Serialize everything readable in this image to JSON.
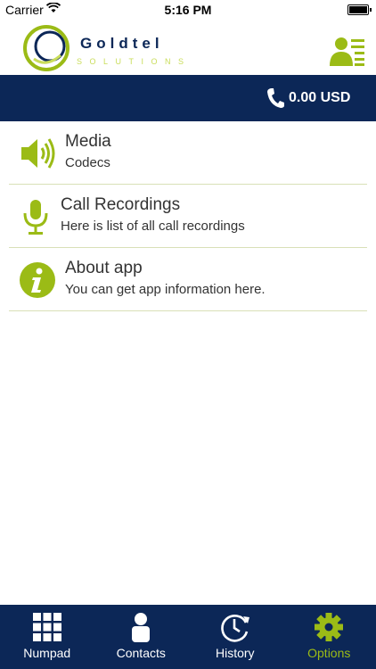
{
  "status_bar": {
    "carrier": "Carrier",
    "time": "5:16 PM"
  },
  "header": {
    "logo_word": "Goldtel",
    "logo_sub": "SOLUTIONS",
    "profile_icon": "profile-list-icon"
  },
  "balance": {
    "text": "0.00 USD",
    "icon": "phone-icon"
  },
  "menu": [
    {
      "title": "Media",
      "subtitle": "Codecs",
      "icon": "speaker-icon"
    },
    {
      "title": "Call Recordings",
      "subtitle": "Here is list of all call recordings",
      "icon": "microphone-icon"
    },
    {
      "title": "About app",
      "subtitle": "You can get app information here.",
      "icon": "info-icon"
    }
  ],
  "tabs": [
    {
      "label": "Numpad",
      "icon": "numpad-grid-icon"
    },
    {
      "label": "Contacts",
      "icon": "person-icon"
    },
    {
      "label": "History",
      "icon": "clock-history-icon"
    },
    {
      "label": "Options",
      "icon": "gear-icon",
      "active": true
    }
  ],
  "colors": {
    "navy": "#0c2757",
    "accent_green": "#9bbb16",
    "divider": "#d9e0b7"
  }
}
